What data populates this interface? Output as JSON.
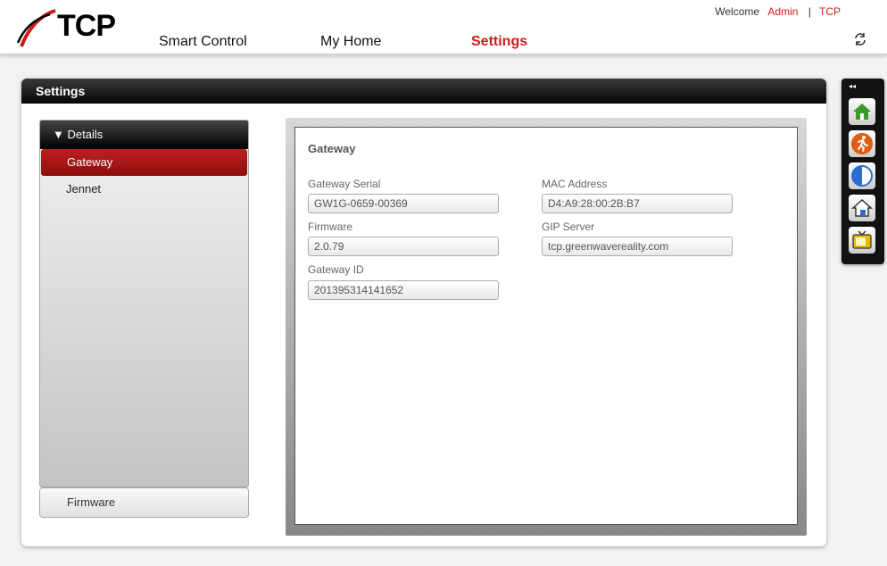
{
  "header": {
    "logo_text": "TCP",
    "welcome_label": "Welcome",
    "user": "Admin",
    "separator": "|",
    "account": "TCP",
    "nav": [
      {
        "label": "Smart Control"
      },
      {
        "label": "My Home"
      },
      {
        "label": "Settings"
      }
    ]
  },
  "panel": {
    "title": "Settings",
    "sidebar": {
      "section": "▼ Details",
      "items": [
        {
          "label": "Gateway"
        },
        {
          "label": "Jennet"
        }
      ],
      "firmware_button": "Firmware"
    },
    "gateway": {
      "title": "Gateway",
      "fields": {
        "serial_label": "Gateway Serial",
        "serial_value": "GW1G-0659-00369",
        "mac_label": "MAC Address",
        "mac_value": "D4:A9:28:00:2B:B7",
        "firmware_label": "Firmware",
        "firmware_value": "2.0.79",
        "gip_label": "GIP Server",
        "gip_value": "tcp.greenwavereality.com",
        "id_label": "Gateway ID",
        "id_value": "201395314141652"
      }
    }
  },
  "dock": {
    "collapse": "◂◂",
    "buttons": [
      "home-icon",
      "running-man-icon",
      "half-moon-icon",
      "house-outline-icon",
      "tv-icon"
    ]
  },
  "colors": {
    "accent_red": "#d01c1c",
    "home_green": "#3a9a2a",
    "scene_orange": "#e05a10",
    "moon_blue": "#2a6fd0",
    "tv_yellow": "#e8b800"
  }
}
